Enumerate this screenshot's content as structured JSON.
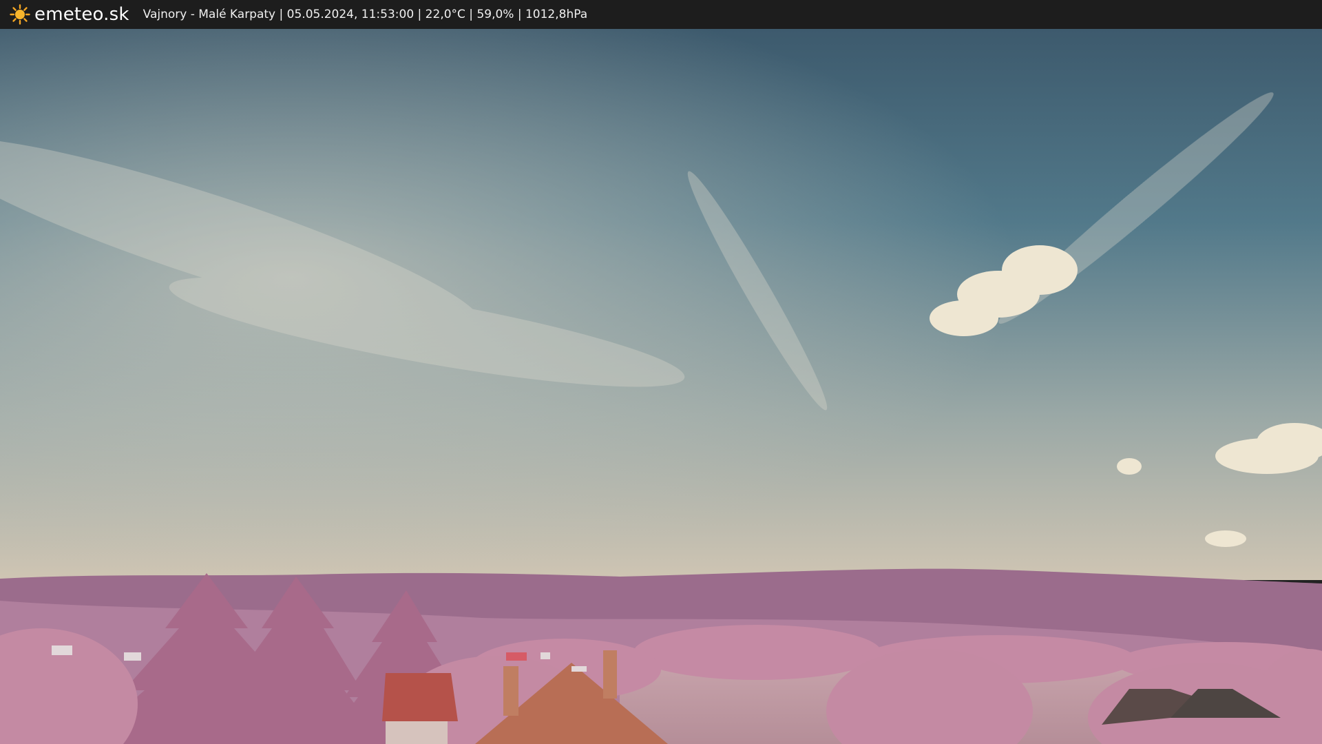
{
  "header": {
    "brand": "emeteo.sk",
    "brand_icon": "sun-icon",
    "caption": "Vajnory - Malé Karpaty | 05.05.2024, 11:53:00 | 22,0°C | 59,0% | 1012,8hPa"
  },
  "colors": {
    "header_bg": "#1d1d1d",
    "sun": "#f5a623",
    "sky_top": "#3f5d70",
    "sky_bottom": "#cdc4b4",
    "hills": "#9a6a8a",
    "foliage": "#c98fa6"
  }
}
